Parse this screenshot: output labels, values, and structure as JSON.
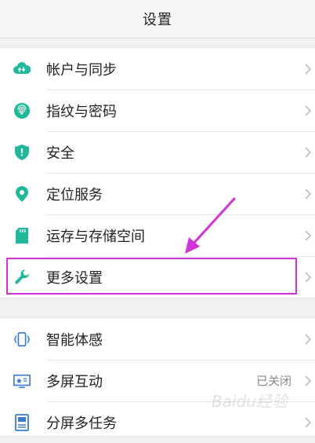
{
  "header": {
    "title": "设置"
  },
  "accent_color": "#1fb89a",
  "highlight_color": "#d233d9",
  "group1": [
    {
      "label": "帐户与同步",
      "icon": "cloud-sync-icon"
    },
    {
      "label": "指纹与密码",
      "icon": "fingerprint-icon"
    },
    {
      "label": "安全",
      "icon": "shield-icon"
    },
    {
      "label": "定位服务",
      "icon": "location-pin-icon"
    },
    {
      "label": "运存与存储空间",
      "icon": "sd-card-icon"
    },
    {
      "label": "更多设置",
      "icon": "wrench-icon"
    }
  ],
  "group2": [
    {
      "label": "智能体感",
      "icon": "motion-sense-icon"
    },
    {
      "label": "多屏互动",
      "icon": "multi-screen-icon",
      "value": "已关闭"
    },
    {
      "label": "分屏多任务",
      "icon": "split-screen-icon"
    }
  ],
  "watermark": "Baidu经验"
}
